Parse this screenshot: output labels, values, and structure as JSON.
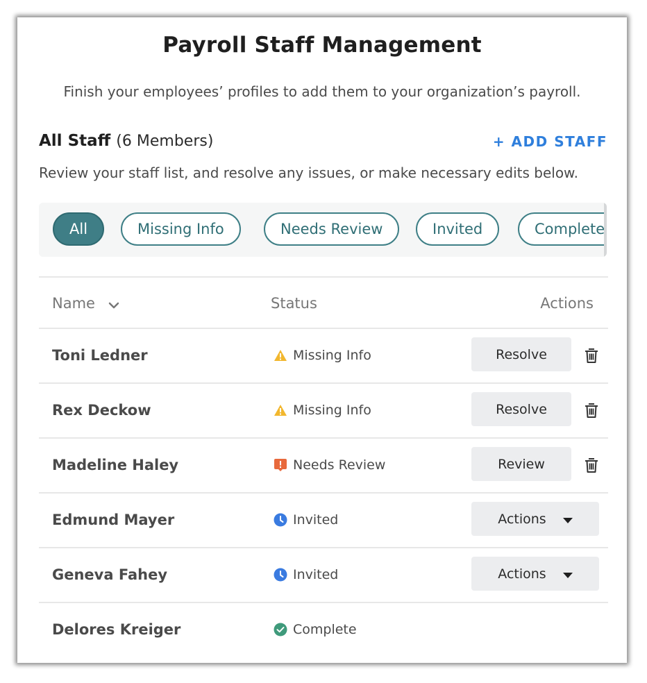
{
  "header": {
    "title": "Payroll Staff Management",
    "subtitle": "Finish your employees’ profiles to add them to your organization’s payroll."
  },
  "staff_section": {
    "heading": "All Staff",
    "count_label": "(6 Members)",
    "add_label": "+ ADD STAFF",
    "description": "Review your staff list, and resolve any issues, or make necessary edits below."
  },
  "filters": [
    {
      "label": "All",
      "active": true
    },
    {
      "label": "Missing Info",
      "active": false
    },
    {
      "label": "Needs Review",
      "active": false
    },
    {
      "label": "Invited",
      "active": false
    },
    {
      "label": "Complete",
      "active": false
    }
  ],
  "table": {
    "columns": {
      "name": "Name",
      "status": "Status",
      "actions": "Actions"
    },
    "rows": [
      {
        "name": "Toni Ledner",
        "status": "Missing Info",
        "status_icon": "warning-icon",
        "action": "Resolve",
        "action_type": "button",
        "deletable": true
      },
      {
        "name": "Rex Deckow",
        "status": "Missing Info",
        "status_icon": "warning-icon",
        "action": "Resolve",
        "action_type": "button",
        "deletable": true
      },
      {
        "name": "Madeline Haley",
        "status": "Needs Review",
        "status_icon": "alert-icon",
        "action": "Review",
        "action_type": "button",
        "deletable": true
      },
      {
        "name": "Edmund Mayer",
        "status": "Invited",
        "status_icon": "clock-icon",
        "action": "Actions",
        "action_type": "dropdown",
        "deletable": false
      },
      {
        "name": "Geneva Fahey",
        "status": "Invited",
        "status_icon": "clock-icon",
        "action": "Actions",
        "action_type": "dropdown",
        "deletable": false
      },
      {
        "name": "Delores Kreiger",
        "status": "Complete",
        "status_icon": "check-circle-icon",
        "action": "",
        "action_type": "none",
        "deletable": false
      }
    ]
  },
  "colors": {
    "accent": "#3f7e86",
    "link": "#2f7fdc",
    "warning": "#f2b72e",
    "review": "#e8693c",
    "invited": "#3a7be0",
    "complete": "#3f9a7b"
  }
}
